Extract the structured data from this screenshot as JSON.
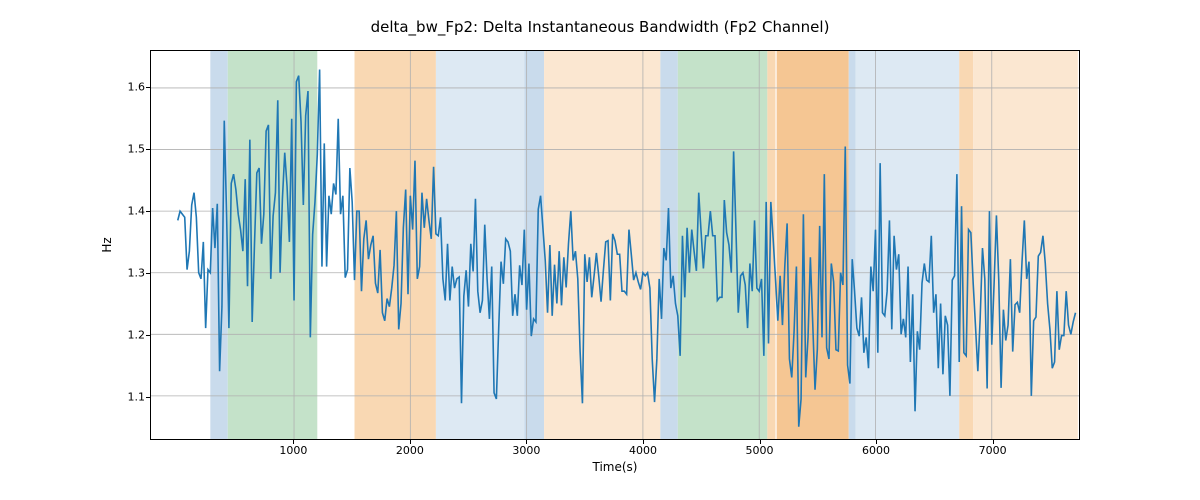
{
  "chart_data": {
    "type": "line",
    "title": "delta_bw_Fp2: Delta Instantaneous Bandwidth (Fp2 Channel)",
    "xlabel": "Time(s)",
    "ylabel": "Hz",
    "xlim": [
      -230,
      7750
    ],
    "ylim": [
      1.03,
      1.66
    ],
    "xticks": [
      1000,
      2000,
      3000,
      4000,
      5000,
      6000,
      7000
    ],
    "yticks": [
      1.1,
      1.2,
      1.3,
      1.4,
      1.5,
      1.6
    ],
    "bands": [
      {
        "x0": 280,
        "x1": 430,
        "color": "#c9dbec"
      },
      {
        "x0": 430,
        "x1": 1200,
        "color": "#c4e2c9"
      },
      {
        "x0": 1520,
        "x1": 2220,
        "color": "#f9d8b3"
      },
      {
        "x0": 2220,
        "x1": 2980,
        "color": "#dde9f3"
      },
      {
        "x0": 2980,
        "x1": 3150,
        "color": "#c9dbec"
      },
      {
        "x0": 3150,
        "x1": 4150,
        "color": "#fbe7d1"
      },
      {
        "x0": 4150,
        "x1": 4300,
        "color": "#c9dbec"
      },
      {
        "x0": 4300,
        "x1": 5070,
        "color": "#c4e2c9"
      },
      {
        "x0": 5070,
        "x1": 5140,
        "color": "#f9d8b3"
      },
      {
        "x0": 5150,
        "x1": 5770,
        "color": "#f5c693"
      },
      {
        "x0": 5770,
        "x1": 5830,
        "color": "#c9dbec"
      },
      {
        "x0": 5830,
        "x1": 6720,
        "color": "#dde9f3"
      },
      {
        "x0": 6720,
        "x1": 6840,
        "color": "#f9d8b3"
      },
      {
        "x0": 6840,
        "x1": 7740,
        "color": "#fbe7d1"
      }
    ],
    "series": [
      {
        "name": "delta_bw_Fp2",
        "color": "#1f77b4",
        "x_start": 0,
        "x_step": 20,
        "values": [
          1.385,
          1.4,
          1.395,
          1.39,
          1.305,
          1.335,
          1.41,
          1.43,
          1.39,
          1.3,
          1.29,
          1.35,
          1.21,
          1.305,
          1.3,
          1.405,
          1.34,
          1.412,
          1.14,
          1.245,
          1.547,
          1.395,
          1.21,
          1.445,
          1.46,
          1.435,
          1.395,
          1.37,
          1.335,
          1.452,
          1.278,
          1.516,
          1.22,
          1.347,
          1.462,
          1.47,
          1.347,
          1.395,
          1.53,
          1.54,
          1.29,
          1.392,
          1.43,
          1.58,
          1.3,
          1.42,
          1.495,
          1.44,
          1.35,
          1.55,
          1.255,
          1.61,
          1.62,
          1.545,
          1.41,
          1.555,
          1.595,
          1.195,
          1.362,
          1.415,
          1.492,
          1.63,
          1.31,
          1.51,
          1.31,
          1.425,
          1.395,
          1.445,
          1.427,
          1.55,
          1.395,
          1.425,
          1.292,
          1.305,
          1.47,
          1.415,
          1.288,
          1.4,
          1.4,
          1.27,
          1.355,
          1.385,
          1.322,
          1.345,
          1.36,
          1.283,
          1.267,
          1.337,
          1.235,
          1.222,
          1.258,
          1.245,
          1.275,
          1.312,
          1.4,
          1.208,
          1.25,
          1.373,
          1.435,
          1.265,
          1.425,
          1.37,
          1.482,
          1.29,
          1.31,
          1.43,
          1.373,
          1.42,
          1.385,
          1.355,
          1.472,
          1.363,
          1.36,
          1.39,
          1.29,
          1.255,
          1.347,
          1.255,
          1.31,
          1.275,
          1.29,
          1.293,
          1.088,
          1.262,
          1.304,
          1.245,
          1.347,
          1.302,
          1.42,
          1.27,
          1.235,
          1.255,
          1.378,
          1.29,
          1.225,
          1.31,
          1.105,
          1.095,
          1.21,
          1.318,
          1.282,
          1.355,
          1.35,
          1.335,
          1.23,
          1.265,
          1.23,
          1.312,
          1.28,
          1.37,
          1.24,
          1.315,
          1.197,
          1.225,
          1.22,
          1.403,
          1.425,
          1.373,
          1.32,
          1.235,
          1.345,
          1.23,
          1.313,
          1.25,
          1.335,
          1.247,
          1.325,
          1.276,
          1.347,
          1.4,
          1.32,
          1.335,
          1.29,
          1.172,
          1.088,
          1.33,
          1.285,
          1.325,
          1.26,
          1.295,
          1.332,
          1.295,
          1.253,
          1.303,
          1.35,
          1.352,
          1.255,
          1.363,
          1.352,
          1.33,
          1.33,
          1.27,
          1.27,
          1.265,
          1.37,
          1.33,
          1.288,
          1.3,
          1.285,
          1.273,
          1.3,
          1.295,
          1.3,
          1.275,
          1.16,
          1.09,
          1.16,
          1.29,
          1.225,
          1.34,
          1.32,
          1.405,
          1.275,
          1.295,
          1.25,
          1.23,
          1.165,
          1.36,
          1.26,
          1.373,
          1.3,
          1.37,
          1.335,
          1.303,
          1.43,
          1.367,
          1.307,
          1.36,
          1.36,
          1.4,
          1.36,
          1.36,
          1.255,
          1.26,
          1.26,
          1.418,
          1.365,
          1.345,
          1.3,
          1.497,
          1.37,
          1.235,
          1.295,
          1.3,
          1.28,
          1.21,
          1.315,
          1.27,
          1.385,
          1.275,
          1.27,
          1.29,
          1.165,
          1.415,
          1.185,
          1.415,
          1.355,
          1.29,
          1.222,
          1.295,
          1.215,
          1.31,
          1.38,
          1.16,
          1.13,
          1.205,
          1.31,
          1.05,
          1.095,
          1.395,
          1.13,
          1.195,
          1.325,
          1.22,
          1.11,
          1.176,
          1.376,
          1.195,
          1.46,
          1.178,
          1.16,
          1.315,
          1.285,
          1.175,
          1.173,
          1.3,
          1.28,
          1.505,
          1.15,
          1.12,
          1.322,
          1.27,
          1.21,
          1.197,
          1.26,
          1.17,
          1.195,
          1.145,
          1.31,
          1.27,
          1.37,
          1.17,
          1.478,
          1.235,
          1.23,
          1.27,
          1.385,
          1.208,
          1.36,
          1.305,
          1.33,
          1.2,
          1.225,
          1.195,
          1.31,
          1.155,
          1.265,
          1.075,
          1.205,
          1.175,
          1.283,
          1.315,
          1.288,
          1.285,
          1.36,
          1.235,
          1.265,
          1.145,
          1.25,
          1.135,
          1.23,
          1.215,
          1.1,
          1.288,
          1.295,
          1.46,
          1.155,
          1.408,
          1.17,
          1.165,
          1.37,
          1.365,
          1.283,
          1.213,
          1.14,
          1.225,
          1.34,
          1.29,
          1.112,
          1.4,
          1.183,
          1.283,
          1.393,
          1.288,
          1.113,
          1.24,
          1.19,
          1.215,
          1.322,
          1.172,
          1.248,
          1.252,
          1.235,
          1.318,
          1.385,
          1.29,
          1.318,
          1.1,
          1.222,
          1.228,
          1.327,
          1.333,
          1.36,
          1.315,
          1.25,
          1.208,
          1.145,
          1.155,
          1.27,
          1.175,
          1.198,
          1.198,
          1.27,
          1.215,
          1.2,
          1.22,
          1.235
        ]
      }
    ]
  }
}
